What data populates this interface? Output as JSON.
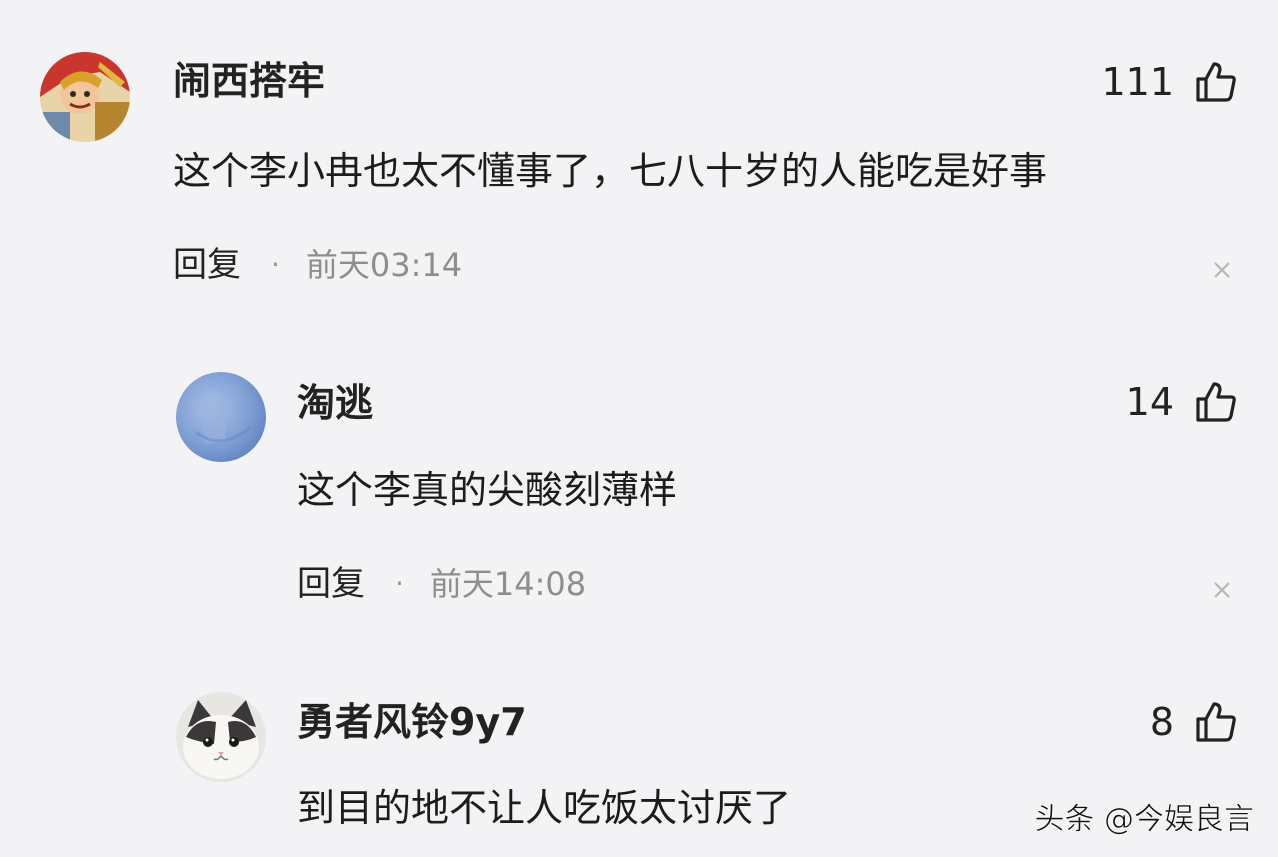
{
  "comments": [
    {
      "username": "闹西搭牢",
      "text": "这个李小冉也太不懂事了，七八十岁的人能吃是好事",
      "reply_label": "回复",
      "separator": "·",
      "time": "前天03:14",
      "likes": "111",
      "avatar_icon": "monkey-king-avatar"
    },
    {
      "username": "淘逃",
      "text": "这个李真的尖酸刻薄样",
      "reply_label": "回复",
      "separator": "·",
      "time": "前天14:08",
      "likes": "14",
      "avatar_icon": "blue-sphere-avatar"
    },
    {
      "username": "勇者风铃9y7",
      "text": "到目的地不让人吃饭太讨厌了",
      "likes": "8",
      "avatar_icon": "cat-avatar"
    }
  ],
  "watermark": "头条 @今娱良言",
  "colors": {
    "background": "#f3f3f6",
    "text": "#222222",
    "muted": "#8e8e8e"
  }
}
